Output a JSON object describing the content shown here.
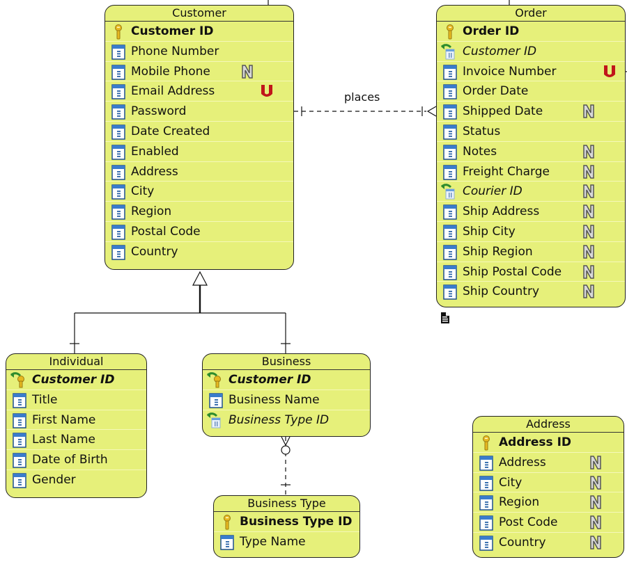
{
  "diagram": {
    "entities": [
      {
        "id": "customer",
        "title": "Customer",
        "attributes": [
          {
            "name": "Customer ID",
            "kind": "pk",
            "icon": "key-icon",
            "badge": ""
          },
          {
            "name": "Phone Number",
            "kind": "column",
            "icon": "column-icon",
            "badge": ""
          },
          {
            "name": "Mobile Phone",
            "kind": "column",
            "icon": "column-icon",
            "badge": "N"
          },
          {
            "name": "Email Address",
            "kind": "column",
            "icon": "column-icon",
            "badge": "U"
          },
          {
            "name": "Password",
            "kind": "column",
            "icon": "column-icon",
            "badge": ""
          },
          {
            "name": "Date Created",
            "kind": "column",
            "icon": "column-icon",
            "badge": ""
          },
          {
            "name": "Enabled",
            "kind": "column",
            "icon": "column-icon",
            "badge": ""
          },
          {
            "name": "Address",
            "kind": "column",
            "icon": "column-icon",
            "badge": ""
          },
          {
            "name": "City",
            "kind": "column",
            "icon": "column-icon",
            "badge": ""
          },
          {
            "name": "Region",
            "kind": "column",
            "icon": "column-icon",
            "badge": ""
          },
          {
            "name": "Postal Code",
            "kind": "column",
            "icon": "column-icon",
            "badge": ""
          },
          {
            "name": "Country",
            "kind": "column",
            "icon": "column-icon",
            "badge": ""
          }
        ]
      },
      {
        "id": "order",
        "title": "Order",
        "attributes": [
          {
            "name": "Order ID",
            "kind": "pk",
            "icon": "key-icon",
            "badge": ""
          },
          {
            "name": "Customer ID",
            "kind": "fk",
            "icon": "foreign-key-icon",
            "badge": ""
          },
          {
            "name": "Invoice Number",
            "kind": "column",
            "icon": "column-icon",
            "badge": "U"
          },
          {
            "name": "Order Date",
            "kind": "column",
            "icon": "column-icon",
            "badge": ""
          },
          {
            "name": "Shipped Date",
            "kind": "column",
            "icon": "column-icon",
            "badge": "N"
          },
          {
            "name": "Status",
            "kind": "column",
            "icon": "column-icon",
            "badge": ""
          },
          {
            "name": "Notes",
            "kind": "column",
            "icon": "column-icon",
            "badge": "N"
          },
          {
            "name": "Freight Charge",
            "kind": "column",
            "icon": "column-icon",
            "badge": "N"
          },
          {
            "name": "Courier ID",
            "kind": "fk",
            "icon": "foreign-key-icon",
            "badge": "N"
          },
          {
            "name": "Ship Address",
            "kind": "column",
            "icon": "column-icon",
            "badge": "N"
          },
          {
            "name": "Ship City",
            "kind": "column",
            "icon": "column-icon",
            "badge": "N"
          },
          {
            "name": "Ship Region",
            "kind": "column",
            "icon": "column-icon",
            "badge": "N"
          },
          {
            "name": "Ship Postal Code",
            "kind": "column",
            "icon": "column-icon",
            "badge": "N"
          },
          {
            "name": "Ship Country",
            "kind": "column",
            "icon": "column-icon",
            "badge": "N"
          }
        ]
      },
      {
        "id": "individual",
        "title": "Individual",
        "attributes": [
          {
            "name": "Customer ID",
            "kind": "pkfk",
            "icon": "primary-foreign-key-icon",
            "badge": ""
          },
          {
            "name": "Title",
            "kind": "column",
            "icon": "column-icon",
            "badge": ""
          },
          {
            "name": "First Name",
            "kind": "column",
            "icon": "column-icon",
            "badge": ""
          },
          {
            "name": "Last Name",
            "kind": "column",
            "icon": "column-icon",
            "badge": ""
          },
          {
            "name": "Date of Birth",
            "kind": "column",
            "icon": "column-icon",
            "badge": ""
          },
          {
            "name": "Gender",
            "kind": "column",
            "icon": "column-icon",
            "badge": ""
          }
        ]
      },
      {
        "id": "business",
        "title": "Business",
        "attributes": [
          {
            "name": "Customer ID",
            "kind": "pkfk",
            "icon": "primary-foreign-key-icon",
            "badge": ""
          },
          {
            "name": "Business Name",
            "kind": "column",
            "icon": "column-icon",
            "badge": ""
          },
          {
            "name": "Business Type ID",
            "kind": "fk",
            "icon": "foreign-key-icon",
            "badge": ""
          }
        ]
      },
      {
        "id": "business-type",
        "title": "Business Type",
        "attributes": [
          {
            "name": "Business Type ID",
            "kind": "pk",
            "icon": "key-icon",
            "badge": ""
          },
          {
            "name": "Type Name",
            "kind": "column",
            "icon": "column-icon",
            "badge": ""
          }
        ]
      },
      {
        "id": "address",
        "title": "Address",
        "attributes": [
          {
            "name": "Address ID",
            "kind": "pk",
            "icon": "key-icon",
            "badge": ""
          },
          {
            "name": "Address",
            "kind": "column",
            "icon": "column-icon",
            "badge": "N"
          },
          {
            "name": "City",
            "kind": "column",
            "icon": "column-icon",
            "badge": "N"
          },
          {
            "name": "Region",
            "kind": "column",
            "icon": "column-icon",
            "badge": "N"
          },
          {
            "name": "Post Code",
            "kind": "column",
            "icon": "column-icon",
            "badge": "N"
          },
          {
            "name": "Country",
            "kind": "column",
            "icon": "column-icon",
            "badge": "N"
          }
        ]
      }
    ],
    "relationships": [
      {
        "from": "Customer",
        "to": "Order",
        "label": "places",
        "style": "dashed",
        "from_cardinality": "one",
        "to_cardinality": "one-or-many"
      },
      {
        "from": "Business",
        "to": "Business Type",
        "label": "",
        "style": "dashed",
        "from_cardinality": "zero-or-many",
        "to_cardinality": "one"
      },
      {
        "from": "Individual",
        "to": "Customer",
        "label": "",
        "style": "generalization"
      },
      {
        "from": "Business",
        "to": "Customer",
        "label": "",
        "style": "generalization"
      }
    ],
    "colors": {
      "entity_fill": "#e6f07a",
      "entity_border": "#222222",
      "null_badge": "#d8d8d8",
      "unique_badge": "#c0161a",
      "key": "#e6b820",
      "column_icon": "#2a64a8",
      "fk_arrow": "#3a9a3a"
    }
  }
}
